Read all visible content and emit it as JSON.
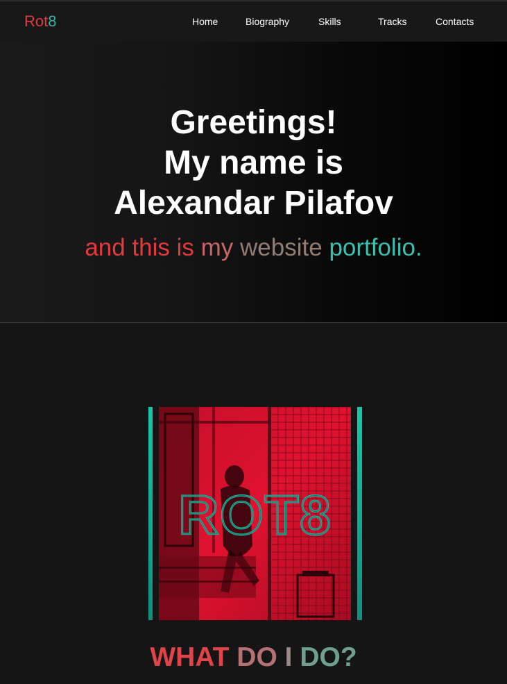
{
  "brand": {
    "part1": "Rot",
    "part2": "8"
  },
  "nav": {
    "items": [
      {
        "label": "Home"
      },
      {
        "label": "Biography"
      },
      {
        "label": "Skills"
      },
      {
        "label": "Tracks"
      },
      {
        "label": "Contacts"
      }
    ]
  },
  "hero": {
    "lines": [
      "Greetings!",
      "My name is",
      "Alexandar Pilafov"
    ],
    "subtitle": {
      "part1": "and this is",
      "part2": "my",
      "part3": "website",
      "part4": "portfolio."
    }
  },
  "logo": {
    "text": "ROT8"
  },
  "section": {
    "heading": {
      "part1": "WHAT",
      "part2": "DO",
      "part3": "I",
      "part4": "DO?"
    }
  },
  "colors": {
    "accent_red": "#e13a40",
    "accent_teal": "#35b5a4",
    "background": "#151515"
  }
}
